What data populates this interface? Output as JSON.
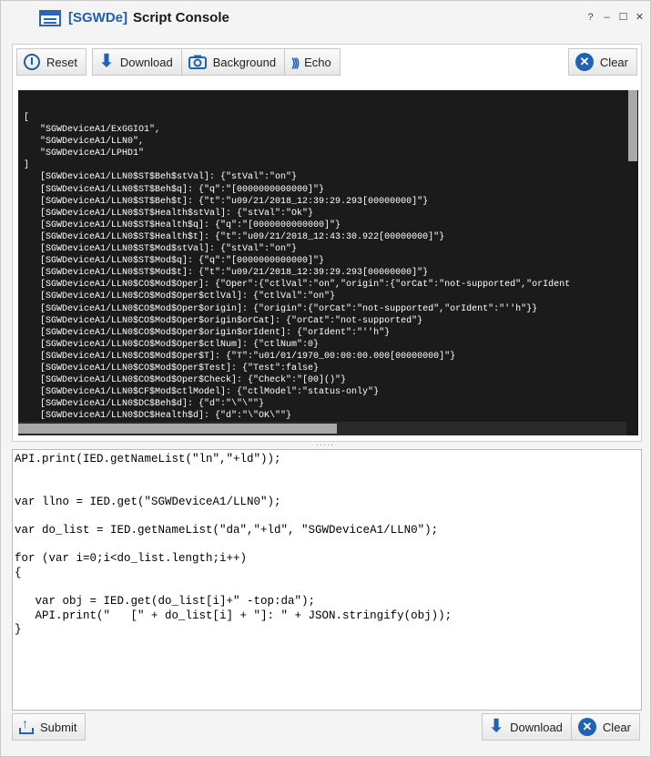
{
  "window": {
    "brand": "[SGWDe]",
    "title": "Script Console",
    "controls": [
      "?",
      "‒",
      "☐",
      "✕"
    ]
  },
  "toolbar": {
    "reset_label": "Reset",
    "download_label": "Download",
    "background_label": "Background",
    "echo_label": "Echo",
    "clear_label": "Clear"
  },
  "console": {
    "output": "[\n   \"SGWDeviceA1/ExGGIO1\",\n   \"SGWDeviceA1/LLN0\",\n   \"SGWDeviceA1/LPHD1\"\n]\n   [SGWDeviceA1/LLN0$ST$Beh$stVal]: {\"stVal\":\"on\"}\n   [SGWDeviceA1/LLN0$ST$Beh$q]: {\"q\":\"[0000000000000]\"}\n   [SGWDeviceA1/LLN0$ST$Beh$t]: {\"t\":\"u09/21/2018_12:39:29.293[00000000]\"}\n   [SGWDeviceA1/LLN0$ST$Health$stVal]: {\"stVal\":\"Ok\"}\n   [SGWDeviceA1/LLN0$ST$Health$q]: {\"q\":\"[0000000000000]\"}\n   [SGWDeviceA1/LLN0$ST$Health$t]: {\"t\":\"u09/21/2018_12:43:30.922[00000000]\"}\n   [SGWDeviceA1/LLN0$ST$Mod$stVal]: {\"stVal\":\"on\"}\n   [SGWDeviceA1/LLN0$ST$Mod$q]: {\"q\":\"[0000000000000]\"}\n   [SGWDeviceA1/LLN0$ST$Mod$t]: {\"t\":\"u09/21/2018_12:39:29.293[00000000]\"}\n   [SGWDeviceA1/LLN0$CO$Mod$Oper]: {\"Oper\":{\"ctlVal\":\"on\",\"origin\":{\"orCat\":\"not-supported\",\"orIdent\n   [SGWDeviceA1/LLN0$CO$Mod$Oper$ctlVal]: {\"ctlVal\":\"on\"}\n   [SGWDeviceA1/LLN0$CO$Mod$Oper$origin]: {\"origin\":{\"orCat\":\"not-supported\",\"orIdent\":\"''h\"}}\n   [SGWDeviceA1/LLN0$CO$Mod$Oper$origin$orCat]: {\"orCat\":\"not-supported\"}\n   [SGWDeviceA1/LLN0$CO$Mod$Oper$origin$orIdent]: {\"orIdent\":\"''h\"}\n   [SGWDeviceA1/LLN0$CO$Mod$Oper$ctlNum]: {\"ctlNum\":0}\n   [SGWDeviceA1/LLN0$CO$Mod$Oper$T]: {\"T\":\"u01/01/1970_00:00:00.000[00000000]\"}\n   [SGWDeviceA1/LLN0$CO$Mod$Oper$Test]: {\"Test\":false}\n   [SGWDeviceA1/LLN0$CO$Mod$Oper$Check]: {\"Check\":\"[00]()\"}\n   [SGWDeviceA1/LLN0$CF$Mod$ctlModel]: {\"ctlModel\":\"status-only\"}\n   [SGWDeviceA1/LLN0$DC$Beh$d]: {\"d\":\"\\\"\\\"\"}\n   [SGWDeviceA1/LLN0$DC$Health$d]: {\"d\":\"\\\"OK\\\"\"}"
  },
  "editor": {
    "code": "API.print(IED.getNameList(\"ln\",\"+ld\"));\n\n\nvar llno = IED.get(\"SGWDeviceA1/LLN0\");\n\nvar do_list = IED.getNameList(\"da\",\"+ld\", \"SGWDeviceA1/LLN0\");\n\nfor (var i=0;i<do_list.length;i++)\n{\n\n   var obj = IED.get(do_list[i]+\" -top:da\");\n   API.print(\"   [\" + do_list[i] + \"]: \" + JSON.stringify(obj));\n}"
  },
  "bottombar": {
    "submit_label": "Submit",
    "download_label": "Download",
    "clear_label": "Clear"
  },
  "colors": {
    "accent": "#1f63b4",
    "console_bg": "#1b1b1b"
  }
}
